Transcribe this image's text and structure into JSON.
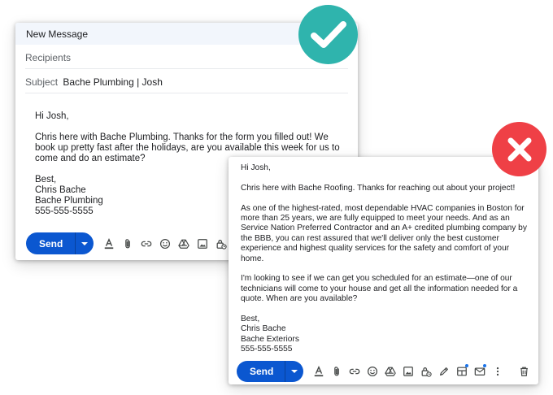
{
  "good_email": {
    "title": "New Message",
    "recipients_placeholder": "Recipients",
    "subject_label": "Subject",
    "subject_value": "Bache Plumbing | Josh",
    "greeting": "Hi Josh,",
    "body": "Chris here with Bache Plumbing. Thanks for the form you filled out! We book up pretty fast after the holidays, are you available this week for us to come and do an estimate?",
    "signoff": "Best,",
    "sig_name": "Chris Bache",
    "sig_company": "Bache Plumbing",
    "sig_phone": "555-555-5555",
    "send_label": "Send"
  },
  "bad_email": {
    "greeting": "Hi Josh,",
    "para1": "Chris here with Bache Roofing. Thanks for reaching out about your project!",
    "para2": "As one of the highest-rated, most dependable HVAC companies in Boston for more than 25 years, we are fully equipped to meet your needs. And as an Service Nation Preferred Contractor and an A+ credited plumbing company by the BBB, you can rest assured that we'll deliver only the best customer experience and highest quality services for the safety and comfort of your home.",
    "para3": "I'm looking to see if we can get you scheduled for an estimate—one of our technicians will come to your house and get all the information needed for a quote. When are you available?",
    "signoff": "Best,",
    "sig_name": "Chris Bache",
    "sig_company": "Bache Exteriors",
    "sig_phone": "555-555-5555",
    "send_label": "Send"
  },
  "icons": {
    "good_toolbar": [
      "format-text-icon",
      "attach-icon",
      "link-icon",
      "emoji-icon",
      "drive-icon",
      "image-icon",
      "confidential-lock-icon"
    ],
    "bad_toolbar": [
      "format-text-icon",
      "attach-icon",
      "link-icon",
      "emoji-icon",
      "drive-icon",
      "image-icon",
      "confidential-lock-icon",
      "signature-pen-icon",
      "layout-icon",
      "mail-template-icon",
      "more-options-icon",
      "trash-icon"
    ],
    "good_badge": "checkmark-icon",
    "bad_badge": "x-icon"
  },
  "colors": {
    "send_blue": "#0b57d0",
    "title_bar": "#f2f6fc",
    "check_teal": "#2fb4ad",
    "x_red": "#ef4046"
  }
}
